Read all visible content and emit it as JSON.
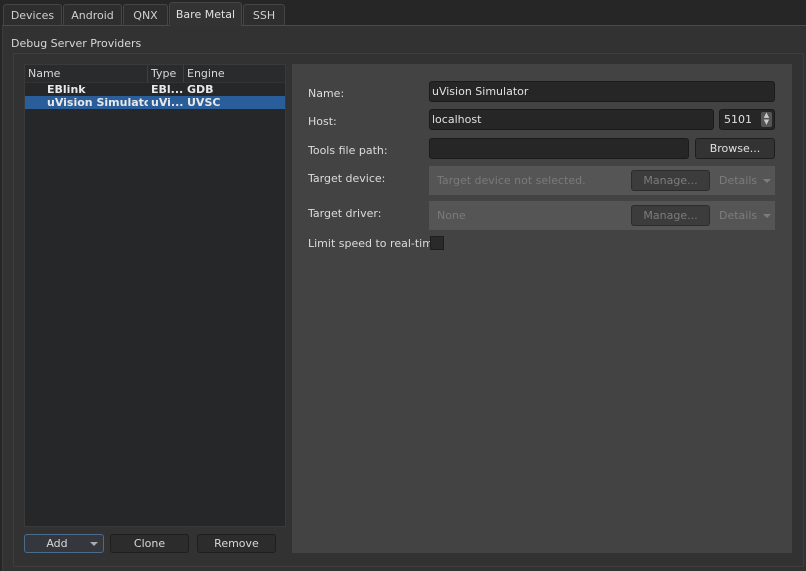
{
  "tabs": [
    {
      "label": "Devices"
    },
    {
      "label": "Android"
    },
    {
      "label": "QNX"
    },
    {
      "label": "Bare Metal",
      "active": true
    },
    {
      "label": "SSH"
    }
  ],
  "group_title": "Debug Server Providers",
  "table": {
    "columns": [
      "Name",
      "Type",
      "Engine"
    ],
    "rows": [
      {
        "name": "EBlink",
        "type": "EBl...",
        "engine": "GDB"
      },
      {
        "name": "uVision Simulator",
        "type": "uVi...",
        "engine": "UVSC",
        "selected": true
      }
    ]
  },
  "buttons": {
    "add": "Add",
    "clone": "Clone",
    "remove": "Remove"
  },
  "form": {
    "name_label": "Name:",
    "name_value": "uVision Simulator",
    "host_label": "Host:",
    "host_value": "localhost",
    "port_value": "5101",
    "tools_label": "Tools file path:",
    "tools_value": "",
    "browse": "Browse...",
    "device_label": "Target device:",
    "device_value": "Target device not selected.",
    "driver_label": "Target driver:",
    "driver_value": "None",
    "manage": "Manage...",
    "details": "Details",
    "limit_label": "Limit speed to real-time:",
    "limit_checked": false
  },
  "colors": {
    "selection": "#2a5e9a",
    "panel": "#434343"
  }
}
